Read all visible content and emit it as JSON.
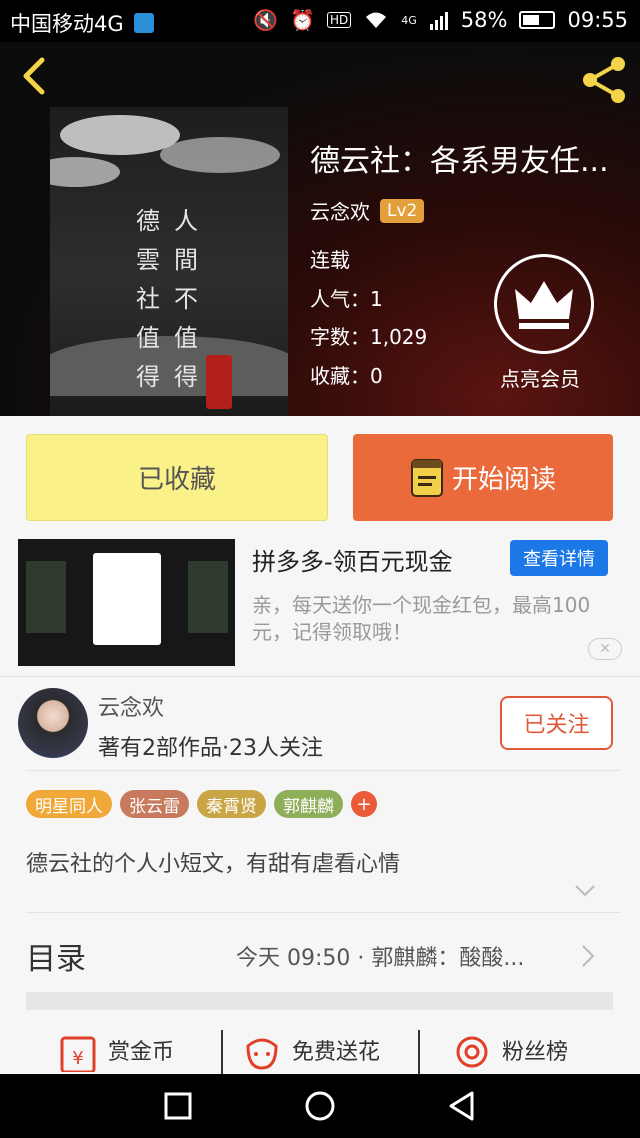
{
  "status_bar": {
    "carrier": "中国移动4G",
    "network": "4G",
    "hd": "HD",
    "battery": "58%",
    "time": "09:55"
  },
  "header": {
    "back_icon": "chevron-left-icon",
    "share_icon": "share-icon"
  },
  "book": {
    "title": "德云社：各系男友任...",
    "author": "云念欢",
    "level": "Lv2",
    "status": "连载",
    "popularity_label": "人气：",
    "popularity": "1",
    "words_label": "字数：",
    "words": "1,029",
    "favorites_label": "收藏：",
    "favorites": "0",
    "cover_text_col1": [
      "德",
      "雲",
      "社",
      "值",
      "得"
    ],
    "cover_text_col2": [
      "人",
      "間",
      "不",
      "值",
      "得"
    ],
    "vip_label": "点亮会员"
  },
  "buttons": {
    "favorited": "已收藏",
    "start_reading": "开始阅读"
  },
  "ad": {
    "title": "拼多多-领百元现金",
    "detail_button": "查看详情",
    "description": "亲，每天送你一个现金红包，最高100元，记得领取哦！"
  },
  "author_card": {
    "name": "云念欢",
    "stats": "著有2部作品·23人关注",
    "follow_button": "已关注"
  },
  "tags": [
    {
      "label": "明星同人",
      "color": "#f0a838"
    },
    {
      "label": "张云雷",
      "color": "#c87a5e"
    },
    {
      "label": "秦霄贤",
      "color": "#c9a546"
    },
    {
      "label": "郭麒麟",
      "color": "#8fae5a"
    }
  ],
  "description": "德云社的个人小短文，有甜有虐看心情",
  "toc": {
    "label": "目录",
    "latest": "今天 09:50 · 郭麒麟：酸酸..."
  },
  "actions": {
    "reward": "赏金币",
    "flowers": "免费送花",
    "fans": "粉丝榜"
  },
  "colors": {
    "accent_orange": "#ea6a3b",
    "fav_yellow": "#fbf189",
    "ad_blue": "#1b78e6",
    "level_badge": "#e3a03a"
  }
}
